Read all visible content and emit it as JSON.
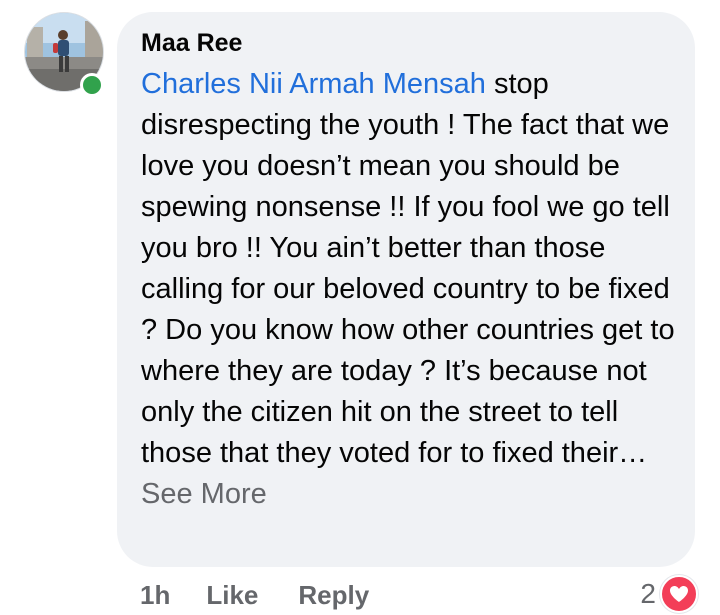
{
  "comment": {
    "author": "Maa Ree",
    "mention": "Charles Nii Armah Mensah",
    "text": " stop disrespecting the youth ! The fact that we love you doesn’t mean you should be spewing nonsense !! If you fool we go tell you bro !! You ain’t better than those calling for our beloved country to be fixed ? Do you know how other countries get to where they are today ? It’s because not only the citizen hit on the street to tell those that they voted for to fixed their… ",
    "see_more": "See More"
  },
  "actions": {
    "timestamp": "1h",
    "like_label": "Like",
    "reply_label": "Reply"
  },
  "reactions": {
    "count": "2",
    "icon": "heart-icon",
    "color": "#f33e58"
  },
  "colors": {
    "bubble": "#f0f2f5",
    "mention": "#216fdb",
    "secondary_text": "#65676b",
    "presence": "#31a24c"
  }
}
